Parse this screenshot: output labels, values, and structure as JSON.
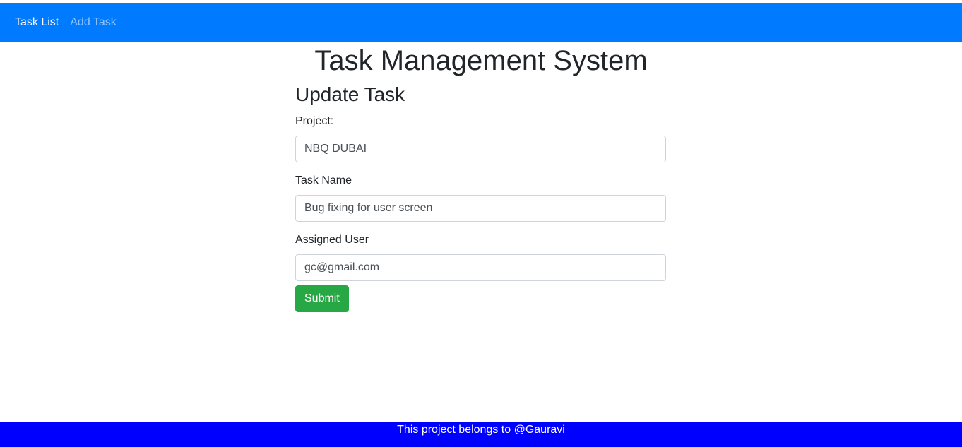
{
  "navbar": {
    "items": [
      {
        "label": "Task List",
        "active": true
      },
      {
        "label": "Add Task",
        "active": false
      }
    ]
  },
  "page": {
    "title": "Task Management System"
  },
  "form": {
    "title": "Update Task",
    "project": {
      "label": "Project:",
      "value": "NBQ DUBAI"
    },
    "task_name": {
      "label": "Task Name",
      "value": "Bug fixing for user screen"
    },
    "assigned_user": {
      "label": "Assigned User",
      "value": "gc@gmail.com"
    },
    "submit_label": "Submit"
  },
  "footer": {
    "text": "This project belongs to @Gauravi"
  },
  "colors": {
    "navbar": "#007bff",
    "submit": "#28a745",
    "footer": "#0000ff"
  }
}
